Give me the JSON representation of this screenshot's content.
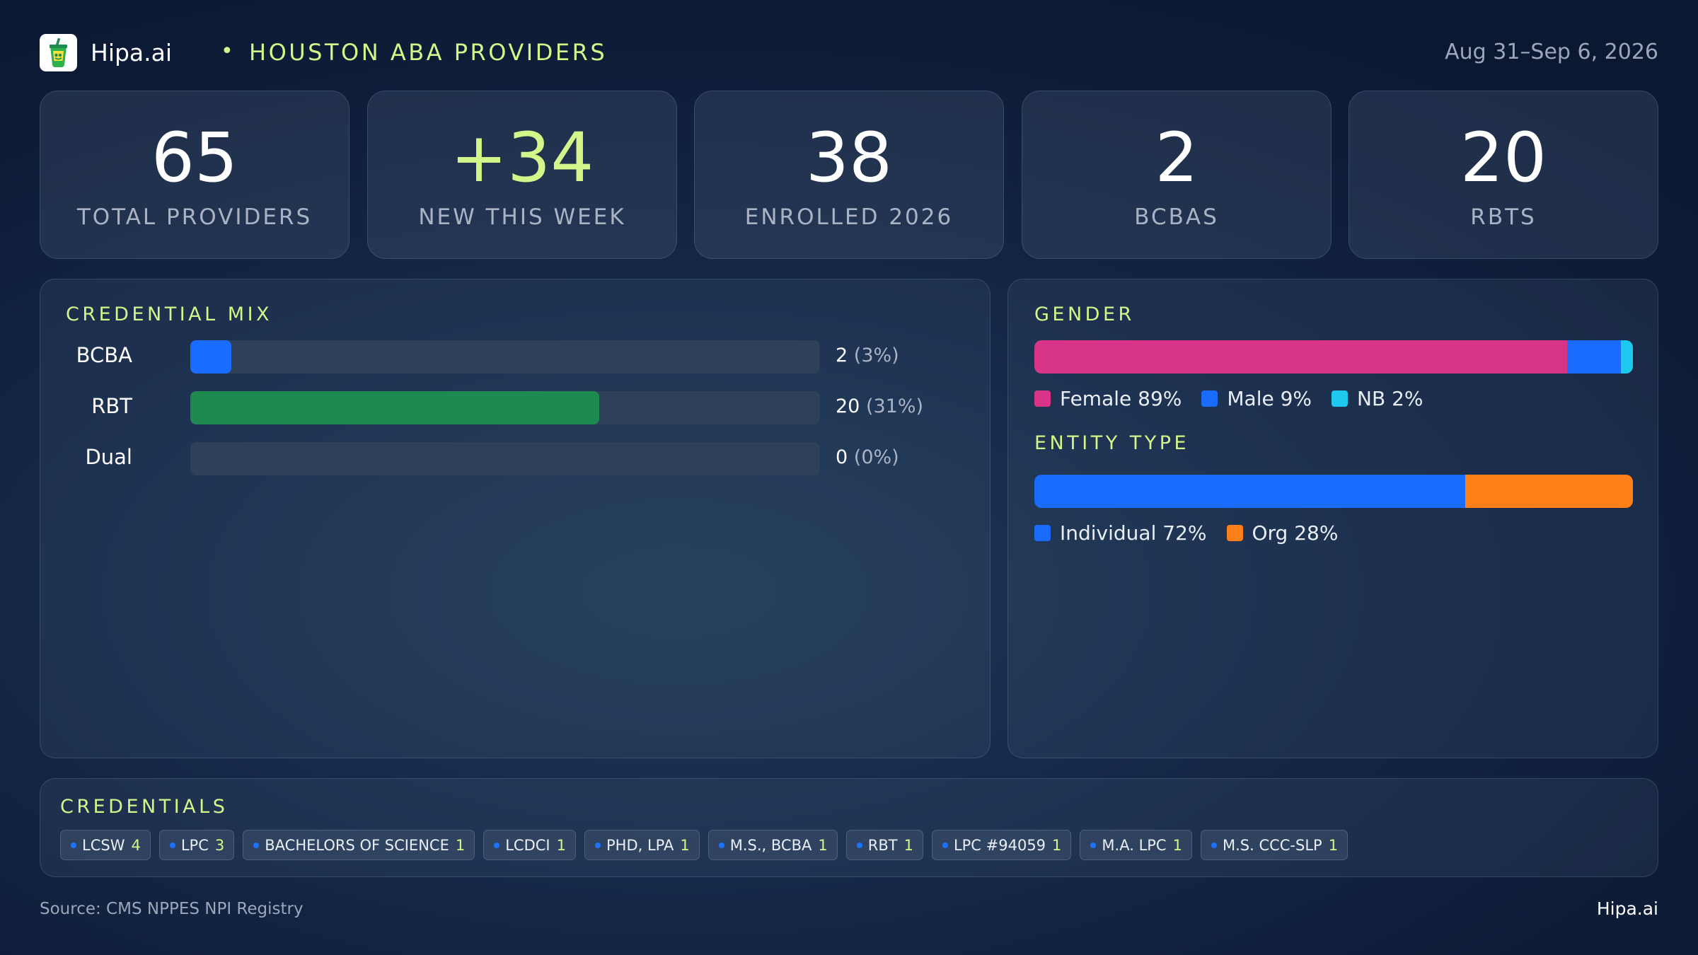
{
  "header": {
    "brand": "Hipa.ai",
    "separator": "•",
    "region": "HOUSTON ABA PROVIDERS",
    "date_range": "Aug 31–Sep 6, 2026"
  },
  "kpis": [
    {
      "value": "65",
      "label": "TOTAL PROVIDERS"
    },
    {
      "value": "+34",
      "label": "NEW THIS WEEK"
    },
    {
      "value": "38",
      "label": "ENROLLED 2026"
    },
    {
      "value": "2",
      "label": "BCBAS"
    },
    {
      "value": "20",
      "label": "RBTS"
    }
  ],
  "credential_mix": {
    "title": "CREDENTIAL MIX"
  },
  "gender": {
    "title": "GENDER"
  },
  "entity_type": {
    "title": "ENTITY TYPE"
  },
  "credentials": {
    "title": "CREDENTIALS",
    "chips": [
      {
        "label": "LCSW",
        "count": "4"
      },
      {
        "label": "LPC",
        "count": "3"
      },
      {
        "label": "BACHELORS OF SCIENCE",
        "count": "1"
      },
      {
        "label": "LCDCI",
        "count": "1"
      },
      {
        "label": "PHD, LPA",
        "count": "1"
      },
      {
        "label": "M.S., BCBA",
        "count": "1"
      },
      {
        "label": "RBT",
        "count": "1"
      },
      {
        "label": "LPC #94059",
        "count": "1"
      },
      {
        "label": "M.A. LPC",
        "count": "1"
      },
      {
        "label": "M.S. CCC-SLP",
        "count": "1"
      }
    ]
  },
  "footer": {
    "source": "Source: CMS NPPES NPI Registry",
    "brand": "Hipa.ai"
  },
  "colors": {
    "accent": "#d4f58a",
    "bcba": "#1a6cff",
    "rbt": "#1f8a4f",
    "female": "#d83588",
    "male": "#1a6cff",
    "nb": "#1ec8ef",
    "individual": "#1a6cff",
    "org": "#ff8019"
  },
  "icons": {
    "logo": "drink-cup-icon"
  },
  "chart_data": [
    {
      "type": "bar",
      "title": "CREDENTIAL MIX",
      "orientation": "horizontal",
      "categories": [
        "BCBA",
        "RBT",
        "Dual"
      ],
      "values": [
        2,
        20,
        0
      ],
      "value_labels": [
        "2",
        "20",
        "0"
      ],
      "pct_labels": [
        "(3%)",
        "(31%)",
        "(0%)"
      ],
      "xlim": [
        0,
        20
      ]
    },
    {
      "type": "bar",
      "stacked": true,
      "title": "GENDER",
      "series": [
        {
          "name": "Female",
          "value": 89,
          "legend": "Female 89%"
        },
        {
          "name": "Male",
          "value": 9,
          "legend": "Male 9%"
        },
        {
          "name": "NB",
          "value": 2,
          "legend": "NB 2%"
        }
      ]
    },
    {
      "type": "bar",
      "stacked": true,
      "title": "ENTITY TYPE",
      "series": [
        {
          "name": "Individual",
          "value": 72,
          "legend": "Individual 72%"
        },
        {
          "name": "Org",
          "value": 28,
          "legend": "Org 28%"
        }
      ]
    }
  ]
}
